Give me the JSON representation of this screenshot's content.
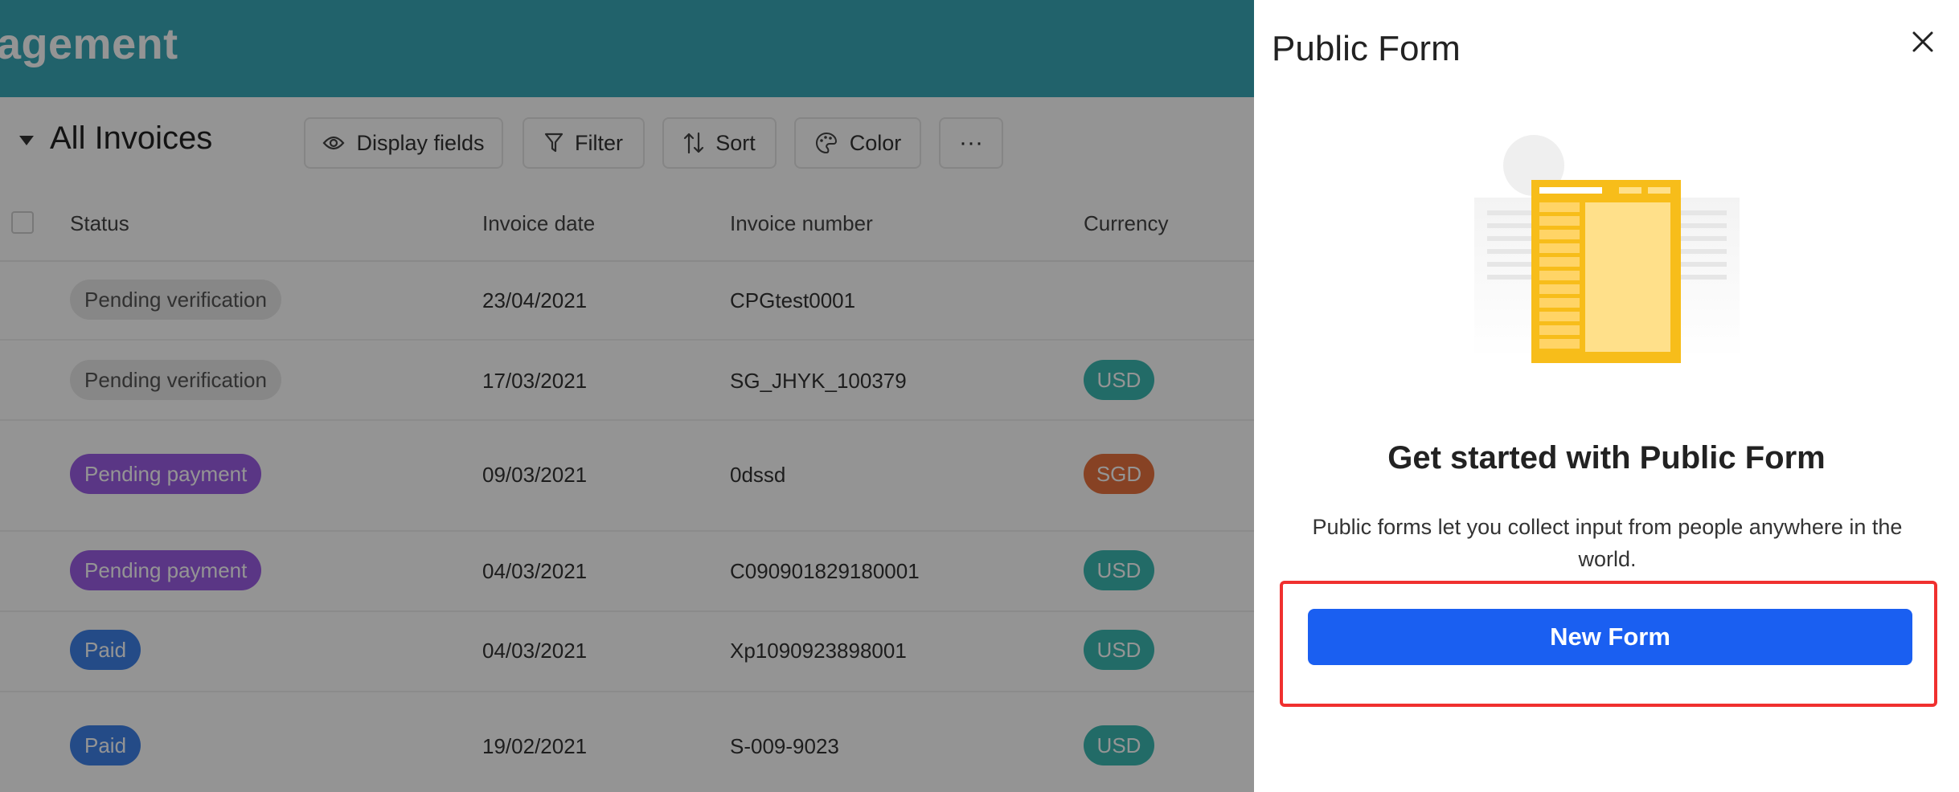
{
  "app": {
    "title": "agement"
  },
  "toolbar": {
    "view_name": "All Invoices",
    "buttons": {
      "display_fields": "Display fields",
      "filter": "Filter",
      "sort": "Sort",
      "color": "Color",
      "more": "···"
    }
  },
  "table": {
    "columns": [
      "Status",
      "Invoice date",
      "Invoice number",
      "Currency"
    ],
    "rows": [
      {
        "status": "Pending verification",
        "date": "23/04/2021",
        "number": "CPGtest0001",
        "currency": ""
      },
      {
        "status": "Pending verification",
        "date": "17/03/2021",
        "number": "SG_JHYK_100379",
        "currency": "USD"
      },
      {
        "status": "Pending payment",
        "date": "09/03/2021",
        "number": "0dssd",
        "currency": "SGD"
      },
      {
        "status": "Pending payment",
        "date": "04/03/2021",
        "number": "C090901829180001",
        "currency": "USD"
      },
      {
        "status": "Paid",
        "date": "04/03/2021",
        "number": "Xp1090923898001",
        "currency": "USD"
      },
      {
        "status": "Paid",
        "date": "19/02/2021",
        "number": "S-009-9023",
        "currency": "USD"
      }
    ]
  },
  "colors": {
    "topbar": "#3aaab8",
    "status_pending_verification": "#e8e8e8",
    "status_pending_payment": "#9b5de5",
    "status_paid": "#3f82e8",
    "currency_usd": "#3cb9b2",
    "currency_sgd": "#e8733f",
    "primary_button": "#1a5ff1",
    "highlight": "#f0302f"
  },
  "panel": {
    "title": "Public Form",
    "heading": "Get started with Public Form",
    "description": "Public forms let you collect input from people anywhere in the world.",
    "new_form_label": "New Form",
    "icons": {
      "close": "close-icon",
      "illustration": "form-illustration"
    }
  }
}
